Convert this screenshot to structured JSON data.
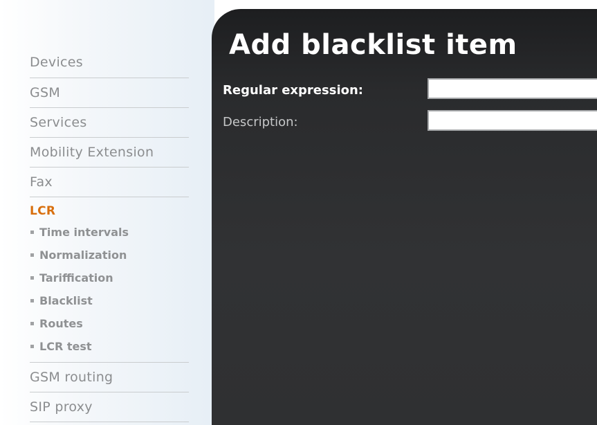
{
  "sidebar": {
    "items": [
      {
        "label": "Devices"
      },
      {
        "label": "GSM"
      },
      {
        "label": "Services"
      },
      {
        "label": "Mobility Extension"
      },
      {
        "label": "Fax"
      },
      {
        "label": "LCR"
      },
      {
        "label": "GSM routing"
      },
      {
        "label": "SIP proxy"
      }
    ],
    "lcr_subitems": [
      {
        "label": "Time intervals"
      },
      {
        "label": "Normalization"
      },
      {
        "label": "Tariffication"
      },
      {
        "label": "Blacklist"
      },
      {
        "label": "Routes"
      },
      {
        "label": "LCR test"
      }
    ],
    "active_item": "LCR"
  },
  "main": {
    "title": "Add blacklist item",
    "form": {
      "regex_label": "Regular expression:",
      "regex_value": "",
      "description_label": "Description:",
      "description_value": ""
    }
  },
  "colors": {
    "active_nav": "#d86f0e",
    "nav_text": "#8b8d8f",
    "panel_bg": "#2a2b2d",
    "title_text": "#ffffff"
  },
  "icons": {
    "sub_item_marker": "square-bullet-icon"
  }
}
